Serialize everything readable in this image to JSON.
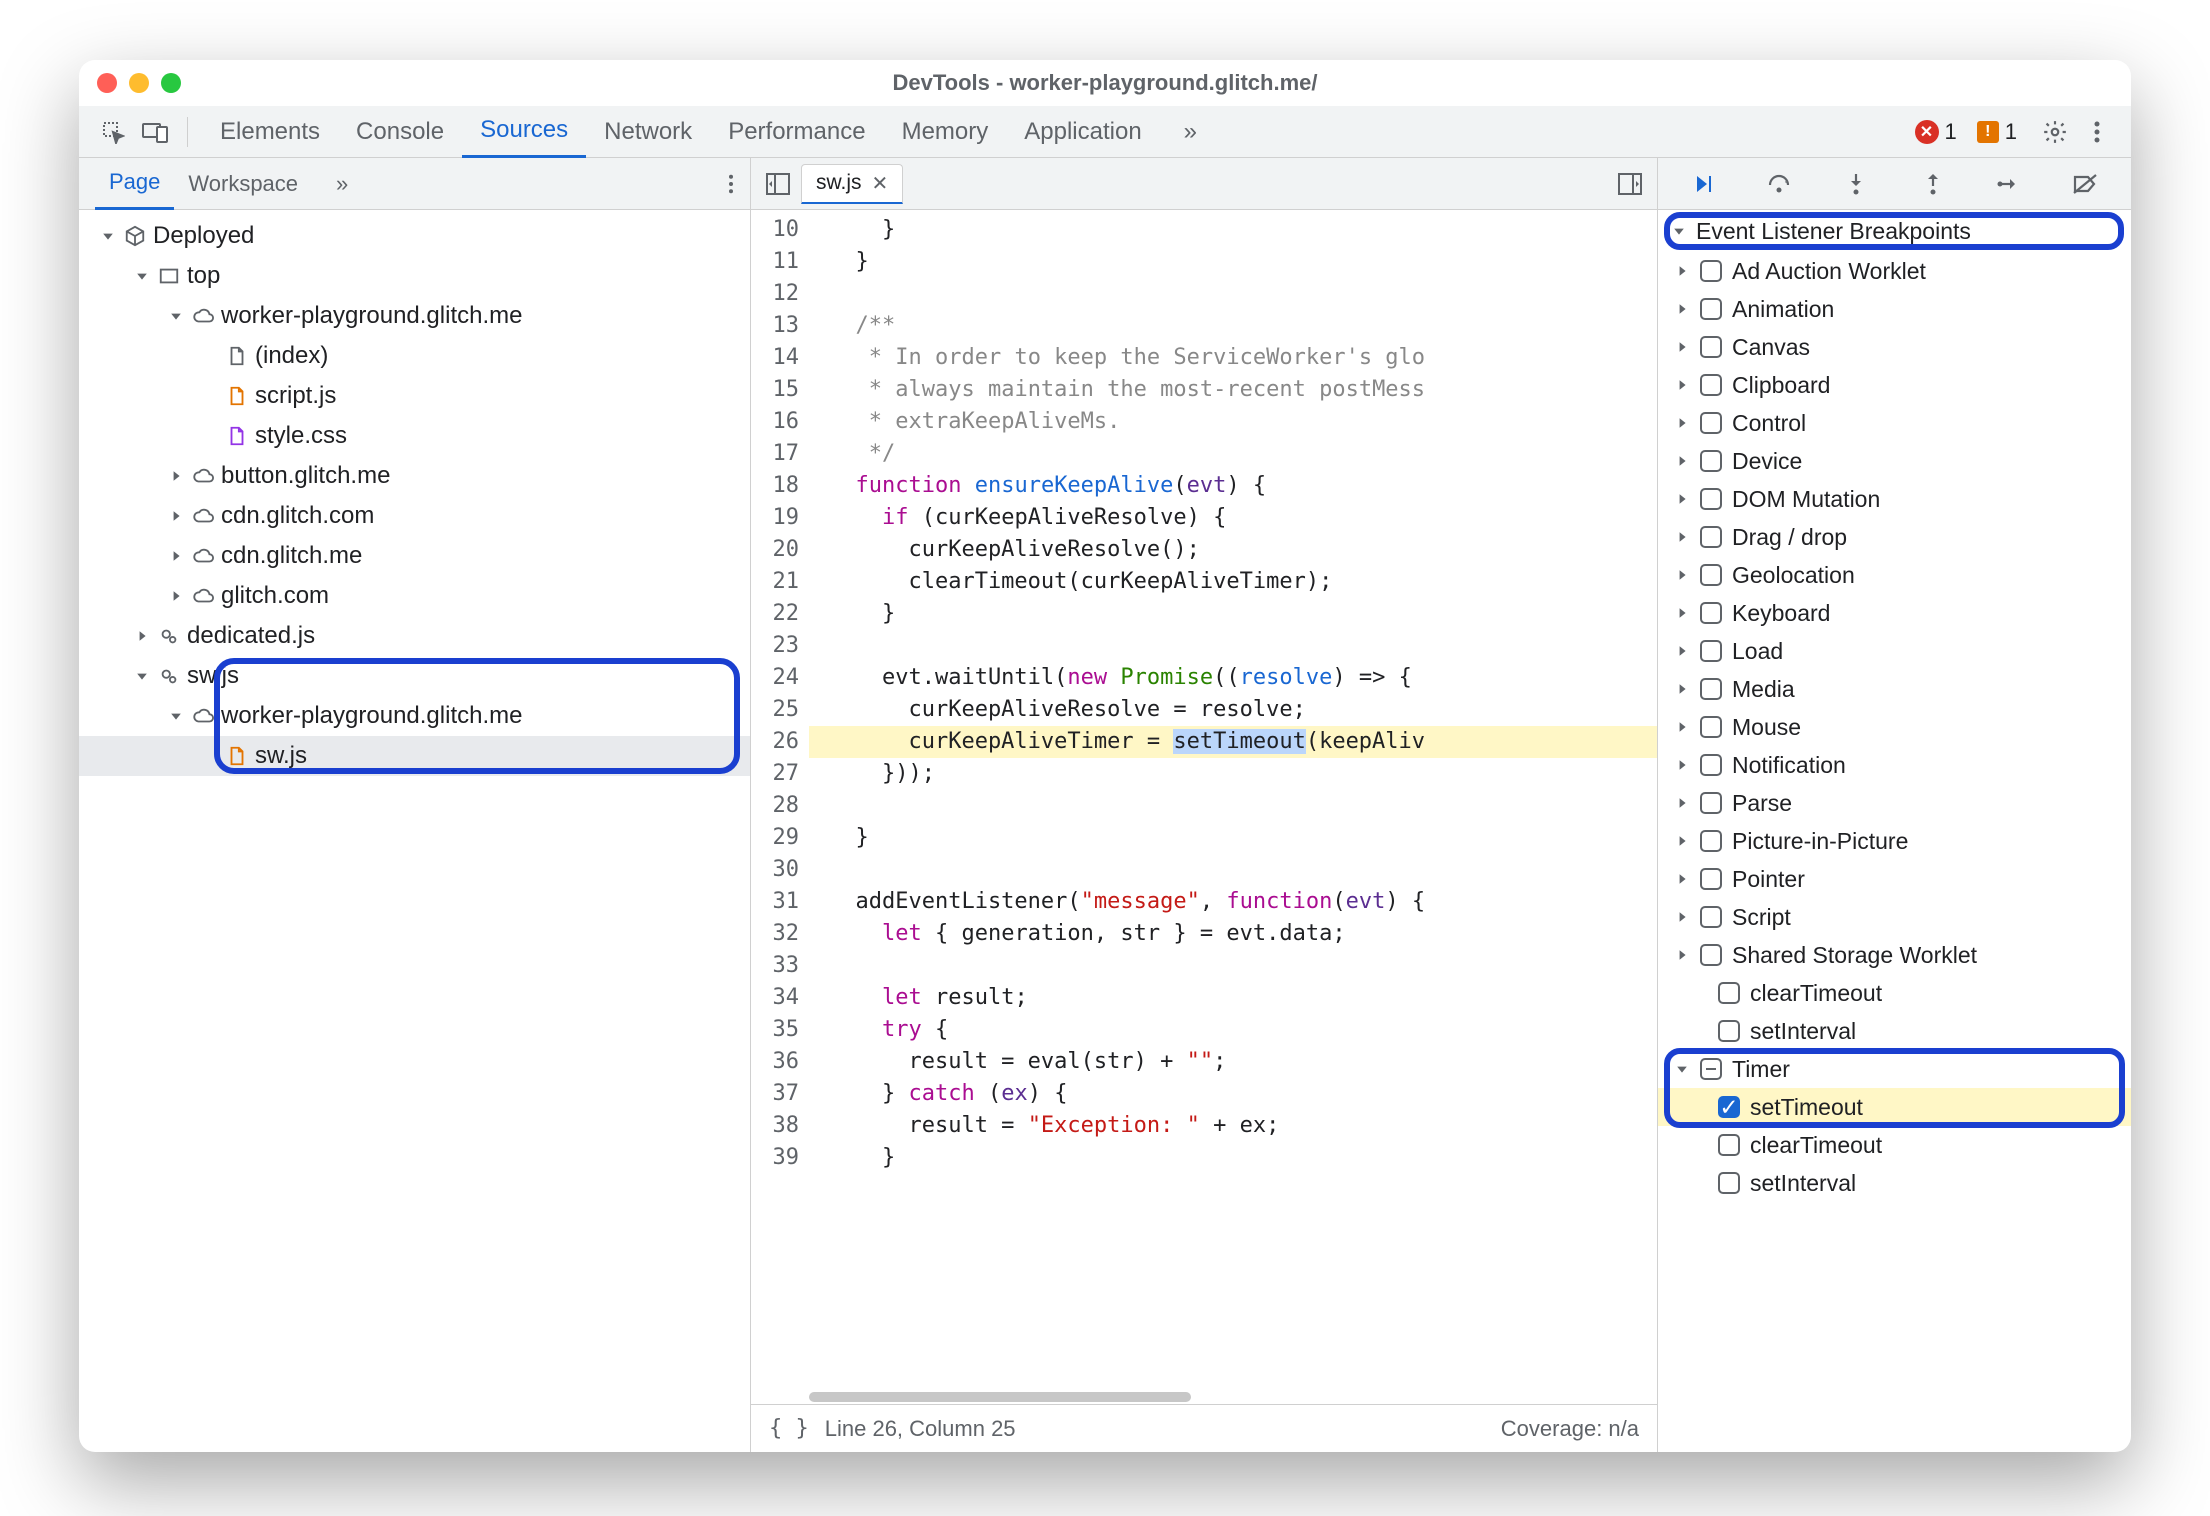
{
  "window_title": "DevTools - worker-playground.glitch.me/",
  "main_tabs": {
    "items": [
      "Elements",
      "Console",
      "Sources",
      "Network",
      "Performance",
      "Memory",
      "Application"
    ],
    "active": "Sources",
    "more": "»",
    "errors_count": "1",
    "warnings_count": "1"
  },
  "left_panel": {
    "tabs": {
      "items": [
        "Page",
        "Workspace"
      ],
      "active": "Page",
      "more": "»"
    },
    "tree": [
      {
        "depth": 0,
        "expand": "down",
        "icon": "cube",
        "label": "Deployed"
      },
      {
        "depth": 1,
        "expand": "down",
        "icon": "frame",
        "label": "top"
      },
      {
        "depth": 2,
        "expand": "down",
        "icon": "cloud",
        "label": "worker-playground.glitch.me"
      },
      {
        "depth": 3,
        "expand": "none",
        "icon": "file",
        "label": "(index)"
      },
      {
        "depth": 3,
        "expand": "none",
        "icon": "file-js",
        "label": "script.js"
      },
      {
        "depth": 3,
        "expand": "none",
        "icon": "file-css",
        "label": "style.css"
      },
      {
        "depth": 2,
        "expand": "right",
        "icon": "cloud",
        "label": "button.glitch.me"
      },
      {
        "depth": 2,
        "expand": "right",
        "icon": "cloud",
        "label": "cdn.glitch.com"
      },
      {
        "depth": 2,
        "expand": "right",
        "icon": "cloud",
        "label": "cdn.glitch.me"
      },
      {
        "depth": 2,
        "expand": "right",
        "icon": "cloud",
        "label": "glitch.com"
      },
      {
        "depth": 1,
        "expand": "right",
        "icon": "gears",
        "label": "dedicated.js"
      },
      {
        "depth": 1,
        "expand": "down",
        "icon": "gears",
        "label": "sw.js",
        "group_start": true
      },
      {
        "depth": 2,
        "expand": "down",
        "icon": "cloud",
        "label": "worker-playground.glitch.me"
      },
      {
        "depth": 3,
        "expand": "none",
        "icon": "file-js",
        "label": "sw.js",
        "selected": true,
        "group_end": true
      }
    ]
  },
  "editor": {
    "open_file": "sw.js",
    "first_line": 10,
    "highlight_line": 26,
    "lines": [
      {
        "n": 10,
        "html": "    }"
      },
      {
        "n": 11,
        "html": "  }"
      },
      {
        "n": 12,
        "html": ""
      },
      {
        "n": 13,
        "html": "  <span class='tok-com'>/**</span>"
      },
      {
        "n": 14,
        "html": "   <span class='tok-com'>* In order to keep the ServiceWorker's glo</span>"
      },
      {
        "n": 15,
        "html": "   <span class='tok-com'>* always maintain the most-recent postMess</span>"
      },
      {
        "n": 16,
        "html": "   <span class='tok-com'>* extraKeepAliveMs.</span>"
      },
      {
        "n": 17,
        "html": "   <span class='tok-com'>*/</span>"
      },
      {
        "n": 18,
        "html": "  <span class='tok-kw'>function</span> <span class='tok-def'>ensureKeepAlive</span>(<span class='tok-id'>evt</span>) {"
      },
      {
        "n": 19,
        "html": "    <span class='tok-kw'>if</span> (curKeepAliveResolve) {"
      },
      {
        "n": 20,
        "html": "      curKeepAliveResolve();"
      },
      {
        "n": 21,
        "html": "      clearTimeout(curKeepAliveTimer);"
      },
      {
        "n": 22,
        "html": "    }"
      },
      {
        "n": 23,
        "html": ""
      },
      {
        "n": 24,
        "html": "    evt.waitUntil(<span class='tok-kw'>new</span> <span class='tok-type'>Promise</span>((<span class='tok-def'>resolve</span>) =&gt; {"
      },
      {
        "n": 25,
        "html": "      curKeepAliveResolve = resolve;"
      },
      {
        "n": 26,
        "html": "      curKeepAliveTimer = <span class='hl-sel'>setTimeout</span>(keepAliv"
      },
      {
        "n": 27,
        "html": "    }));"
      },
      {
        "n": 28,
        "html": ""
      },
      {
        "n": 29,
        "html": "  }"
      },
      {
        "n": 30,
        "html": ""
      },
      {
        "n": 31,
        "html": "  addEventListener(<span class='tok-str'>\"message\"</span>, <span class='tok-kw'>function</span>(<span class='tok-id'>evt</span>) {"
      },
      {
        "n": 32,
        "html": "    <span class='tok-kw'>let</span> { generation, str } = evt.data;"
      },
      {
        "n": 33,
        "html": ""
      },
      {
        "n": 34,
        "html": "    <span class='tok-kw'>let</span> result;"
      },
      {
        "n": 35,
        "html": "    <span class='tok-kw'>try</span> {"
      },
      {
        "n": 36,
        "html": "      result = eval(str) + <span class='tok-str'>\"\"</span>;"
      },
      {
        "n": 37,
        "html": "    } <span class='tok-kw'>catch</span> (<span class='tok-id'>ex</span>) {"
      },
      {
        "n": 38,
        "html": "      result = <span class='tok-str'>\"Exception: \"</span> + ex;"
      },
      {
        "n": 39,
        "html": "    }"
      }
    ],
    "status": {
      "line_col": "Line 26, Column 25",
      "coverage": "Coverage: n/a"
    }
  },
  "debugger": {
    "section_title": "Event Listener Breakpoints",
    "categories": [
      {
        "label": "Ad Auction Worklet",
        "expanded": false,
        "checked": false
      },
      {
        "label": "Animation",
        "expanded": false,
        "checked": false
      },
      {
        "label": "Canvas",
        "expanded": false,
        "checked": false
      },
      {
        "label": "Clipboard",
        "expanded": false,
        "checked": false
      },
      {
        "label": "Control",
        "expanded": false,
        "checked": false
      },
      {
        "label": "Device",
        "expanded": false,
        "checked": false
      },
      {
        "label": "DOM Mutation",
        "expanded": false,
        "checked": false
      },
      {
        "label": "Drag / drop",
        "expanded": false,
        "checked": false
      },
      {
        "label": "Geolocation",
        "expanded": false,
        "checked": false
      },
      {
        "label": "Keyboard",
        "expanded": false,
        "checked": false
      },
      {
        "label": "Load",
        "expanded": false,
        "checked": false
      },
      {
        "label": "Media",
        "expanded": false,
        "checked": false
      },
      {
        "label": "Mouse",
        "expanded": false,
        "checked": false
      },
      {
        "label": "Notification",
        "expanded": false,
        "checked": false
      },
      {
        "label": "Parse",
        "expanded": false,
        "checked": false
      },
      {
        "label": "Picture-in-Picture",
        "expanded": false,
        "checked": false
      },
      {
        "label": "Pointer",
        "expanded": false,
        "checked": false
      },
      {
        "label": "Script",
        "expanded": false,
        "checked": false
      },
      {
        "label": "Shared Storage Worklet",
        "expanded": false,
        "checked": false
      },
      {
        "label": "Timer",
        "expanded": true,
        "checked": "mixed",
        "highlight": true,
        "children": [
          {
            "label": "setTimeout",
            "checked": true,
            "highlight": true
          },
          {
            "label": "clearTimeout",
            "checked": false
          },
          {
            "label": "setInterval",
            "checked": false
          }
        ]
      }
    ]
  }
}
